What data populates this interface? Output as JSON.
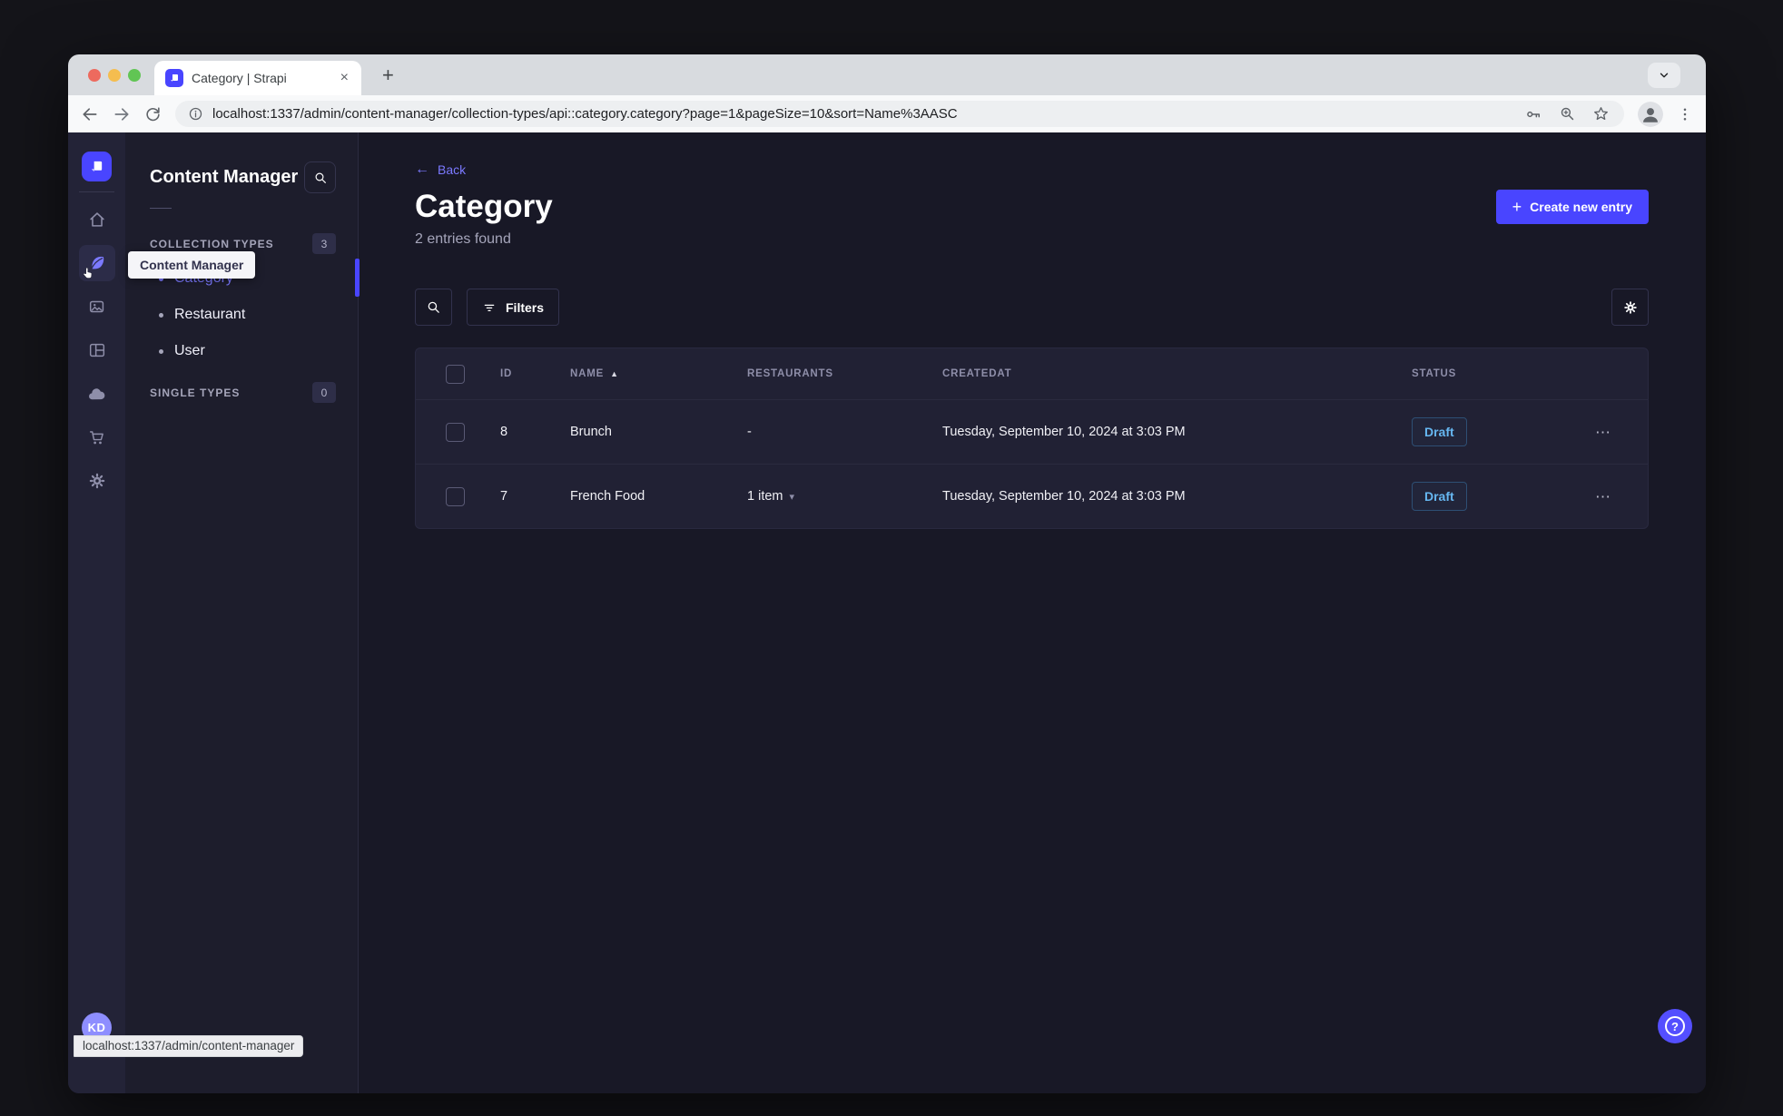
{
  "glyphs": {
    "close": "×",
    "plus": "+",
    "back_arrow": "←",
    "sort_asc": "▲",
    "caret_down": "▾",
    "ellipsis": "⋯",
    "question": "?"
  },
  "colors": {
    "accent": "#4945ff",
    "link": "#7b79ff",
    "draft": "#66b7f1",
    "page_bg": "#181826"
  },
  "browser": {
    "tab_title": "Category | Strapi",
    "url": "localhost:1337/admin/content-manager/collection-types/api::category.category?page=1&pageSize=10&sort=Name%3AASC",
    "status_bar": "localhost:1337/admin/content-manager"
  },
  "rail": {
    "tooltip": "Content Manager",
    "avatar_initials": "KD"
  },
  "subnav": {
    "title": "Content Manager",
    "sections": [
      {
        "label": "COLLECTION TYPES",
        "count": "3",
        "items": [
          {
            "label": "Category"
          },
          {
            "label": "Restaurant"
          },
          {
            "label": "User"
          }
        ]
      },
      {
        "label": "SINGLE TYPES",
        "count": "0",
        "items": []
      }
    ]
  },
  "main": {
    "back": "Back",
    "title": "Category",
    "subtitle": "2 entries found",
    "create": "Create new entry",
    "filters": "Filters",
    "table": {
      "columns": [
        "ID",
        "NAME",
        "RESTAURANTS",
        "CREATEDAT",
        "STATUS"
      ],
      "rows": [
        {
          "id": "8",
          "name": "Brunch",
          "restaurants": "-",
          "createdAt": "Tuesday, September 10, 2024 at 3:03 PM",
          "status": "Draft"
        },
        {
          "id": "7",
          "name": "French Food",
          "restaurants": "1 item",
          "createdAt": "Tuesday, September 10, 2024 at 3:03 PM",
          "status": "Draft"
        }
      ]
    }
  }
}
